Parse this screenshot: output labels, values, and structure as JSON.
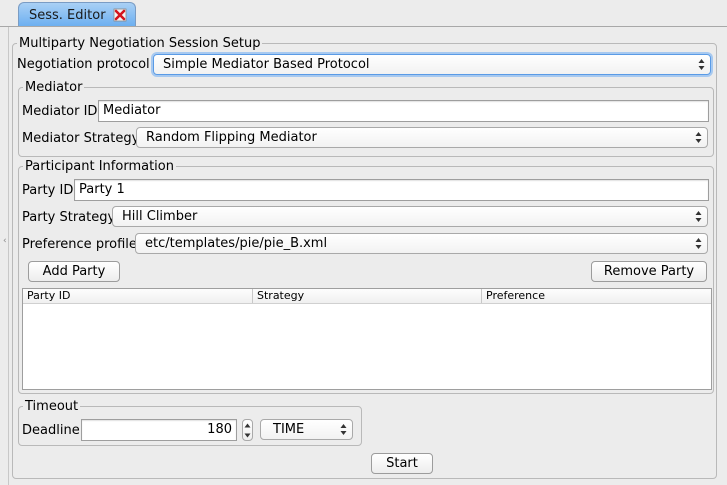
{
  "tab": {
    "label": "Sess. Editor",
    "close_icon": "close-icon",
    "accent": "#6aaef0"
  },
  "setup": {
    "title": "Multiparty Negotiation Session Setup",
    "protocol_label": "Negotiation protocol",
    "protocol_value": "Simple Mediator Based Protocol"
  },
  "mediator": {
    "title": "Mediator",
    "id_label": "Mediator ID",
    "id_value": "Mediator",
    "strategy_label": "Mediator Strategy",
    "strategy_value": "Random Flipping Mediator"
  },
  "participant": {
    "title": "Participant Information",
    "party_id_label": "Party ID",
    "party_id_value": "Party 1",
    "party_strategy_label": "Party Strategy",
    "party_strategy_value": "Hill Climber",
    "preference_label": "Preference profile",
    "preference_value": "etc/templates/pie/pie_B.xml",
    "add_button": "Add Party",
    "remove_button": "Remove Party",
    "table": {
      "columns": [
        "Party ID",
        "Strategy",
        "Preference"
      ],
      "rows": []
    }
  },
  "timeout": {
    "title": "Timeout",
    "deadline_label": "Deadline",
    "deadline_value": "180",
    "unit_value": "TIME"
  },
  "start_button": "Start",
  "focus_color": "#5a9be6"
}
